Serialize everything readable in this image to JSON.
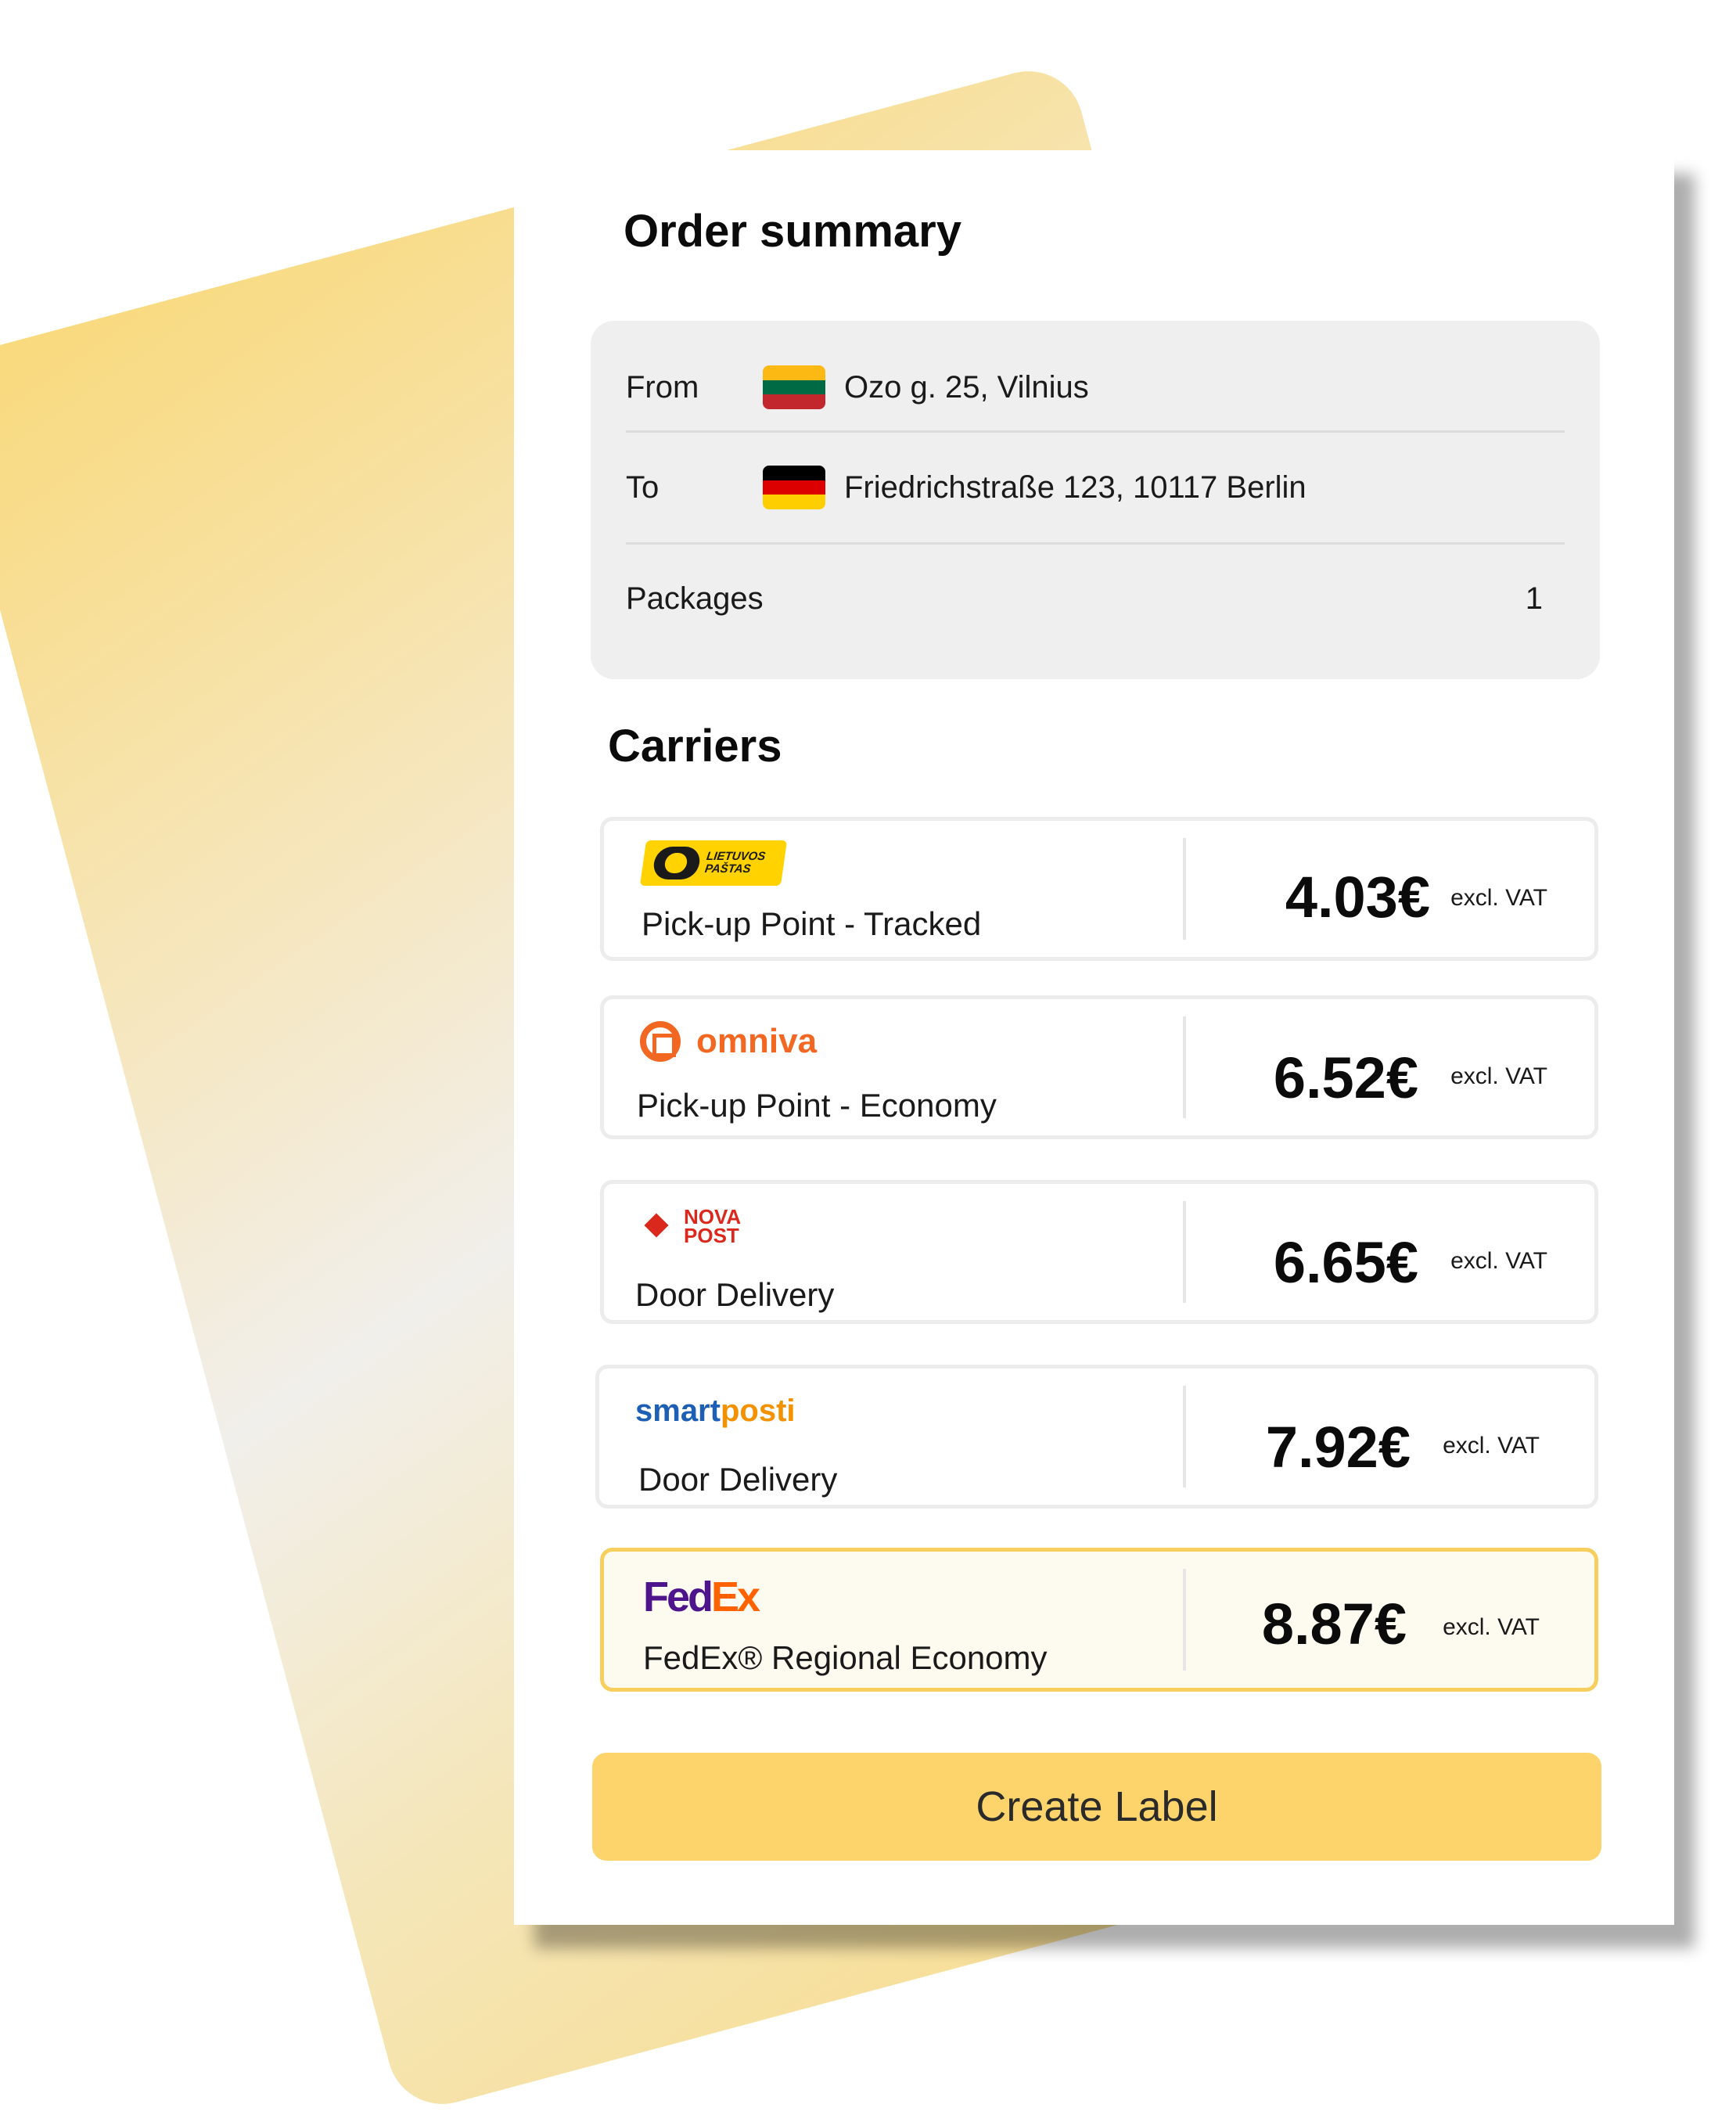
{
  "order_summary": {
    "title": "Order summary",
    "from_label": "From",
    "from_address": "Ozo g. 25, Vilnius",
    "from_flag": "lithuania-flag",
    "to_label": "To",
    "to_address": "Friedrichstraße 123, 10117 Berlin",
    "to_flag": "germany-flag",
    "packages_label": "Packages",
    "packages_count": "1"
  },
  "carriers": {
    "title": "Carriers",
    "items": [
      {
        "logo": "lietuvos-pastas-logo",
        "logo_text_line1": "LIETUVOS",
        "logo_text_line2": "PAŠTAS",
        "service": "Pick-up Point - Tracked",
        "price": "4.03€",
        "vat": "excl. VAT",
        "selected": false
      },
      {
        "logo": "omniva-logo",
        "logo_text": "omniva",
        "service": "Pick-up Point - Economy",
        "price": "6.52€",
        "vat": "excl. VAT",
        "selected": false
      },
      {
        "logo": "nova-post-logo",
        "logo_text_line1": "NOVA",
        "logo_text_line2": "POST",
        "service": "Door Delivery",
        "price": "6.65€",
        "vat": "excl. VAT",
        "selected": false
      },
      {
        "logo": "smartposti-logo",
        "logo_text_part1": "smart",
        "logo_text_part2": "posti",
        "service": "Door Delivery",
        "price": "7.92€",
        "vat": "excl. VAT",
        "selected": false
      },
      {
        "logo": "fedex-logo",
        "logo_text_part1": "Fed",
        "logo_text_part2": "Ex",
        "service": "FedEx® Regional Economy",
        "price": "8.87€",
        "vat": "excl. VAT",
        "selected": true
      }
    ]
  },
  "actions": {
    "create_label": "Create Label"
  },
  "colors": {
    "accent": "#fdd46b",
    "selected_border": "#f7cf5e",
    "summary_bg": "#efefef"
  }
}
